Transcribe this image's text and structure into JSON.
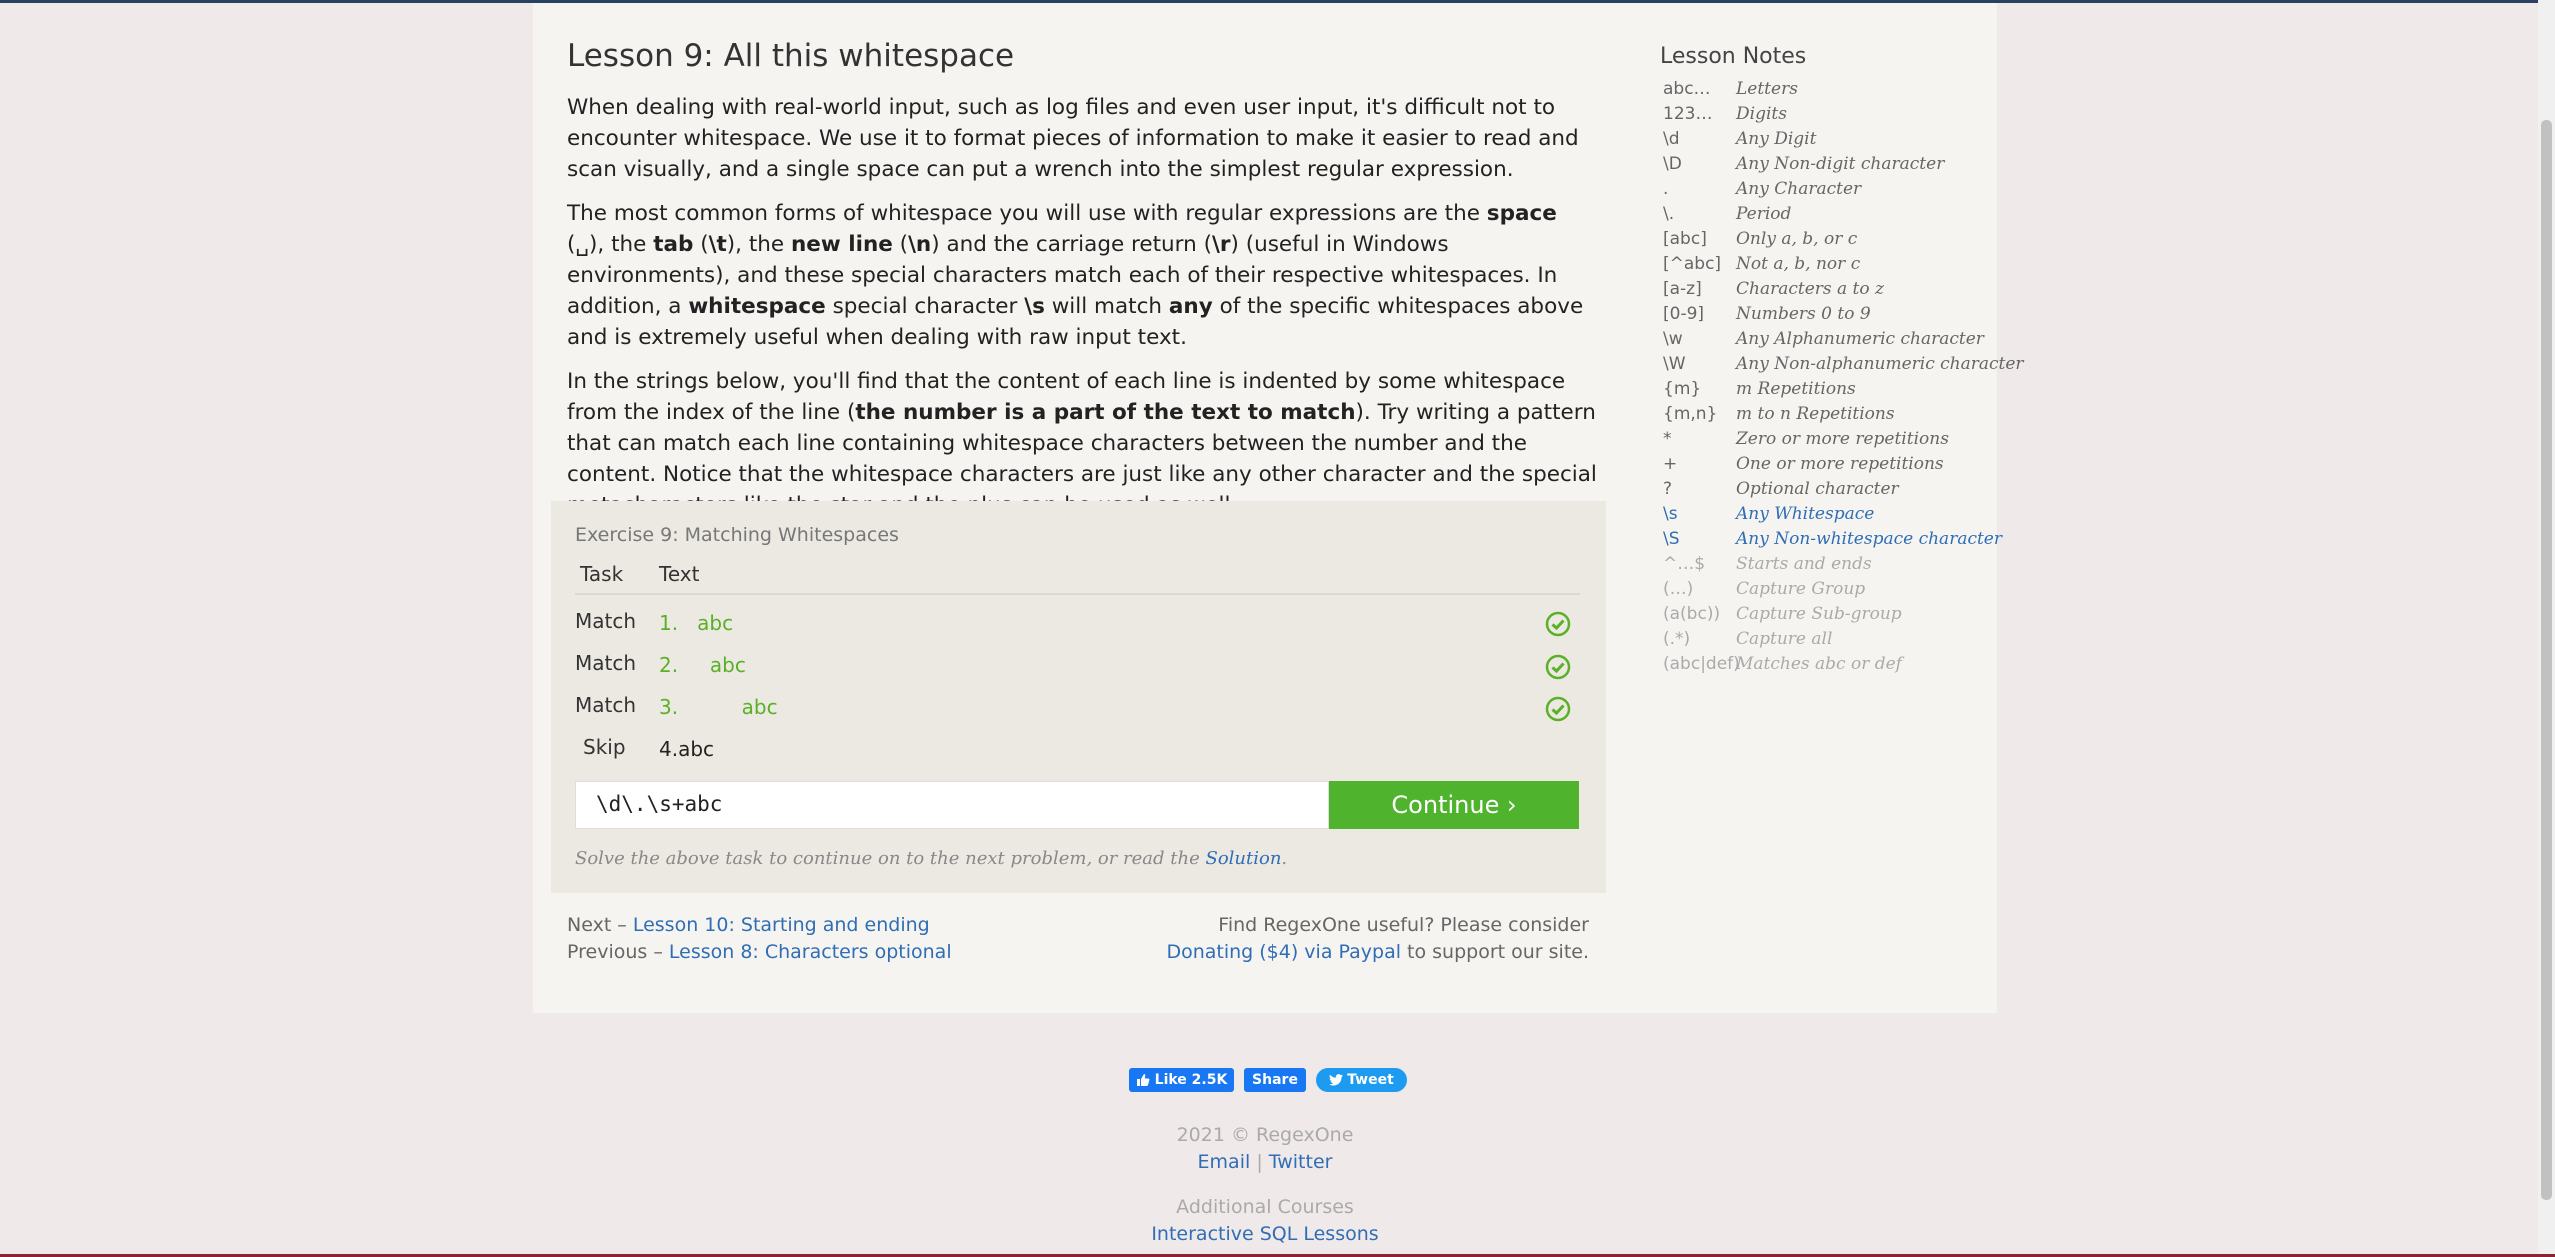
{
  "lesson": {
    "title": "Lesson 9: All this whitespace",
    "p1": "When dealing with real-world input, such as log files and even user input, it's difficult not to encounter whitespace. We use it to format pieces of information to make it easier to read and scan visually, and a single space can put a wrench into the simplest regular expression.",
    "p2": {
      "a": "The most common forms of whitespace you will use with regular expressions are the ",
      "b1": "space",
      "c": " (␣), the ",
      "b2": "tab",
      "d": " (",
      "b3": "\\t",
      "e": "), the ",
      "b4": "new line",
      "f": " (",
      "b5": "\\n",
      "g": ") and the carriage return (",
      "b6": "\\r",
      "h": ") (useful in Windows environments), and these special characters match each of their respective whitespaces. In addition, a ",
      "b7": "whitespace",
      "i": " special character ",
      "b8": "\\s",
      "j": " will match ",
      "b9": "any",
      "k": " of the specific whitespaces above and is extremely useful when dealing with raw input text."
    },
    "p3": {
      "a": "In the strings below, you'll find that the content of each line is indented by some whitespace from the index of the line (",
      "b": "the number is a part of the text to match",
      "c": "). Try writing a pattern that can match each line containing whitespace characters between the number and the content. Notice that the whitespace characters are just like any other character and the special metacharacters like the star and the plus can be used as well."
    }
  },
  "exercise": {
    "title": "Exercise 9: Matching Whitespaces",
    "col_task": "Task",
    "col_text": "Text",
    "rows": [
      {
        "task": "Match",
        "text": "1.   abc",
        "status": "matched"
      },
      {
        "task": "Match",
        "text": "2.     abc",
        "status": "matched"
      },
      {
        "task": "Match",
        "text": "3.          abc",
        "status": "matched"
      },
      {
        "task": "Skip",
        "text": "4.abc",
        "status": "none"
      }
    ],
    "input_value": "\\d\\.\\s+abc",
    "continue_label": "Continue ›",
    "hint_text": "Solve the above task to continue on to the next problem, or read the ",
    "hint_link": "Solution",
    "hint_end": "."
  },
  "nav": {
    "next_prefix": "Next – ",
    "next_link": "Lesson 10: Starting and ending",
    "prev_prefix": "Previous – ",
    "prev_link": "Lesson 8: Characters optional",
    "donate_line1": "Find RegexOne useful? Please consider",
    "donate_link": "Donating ($4) via Paypal",
    "donate_end": " to support our site."
  },
  "notes": {
    "title": "Lesson Notes",
    "items": [
      {
        "k": "abc…",
        "v": "Letters",
        "state": "normal"
      },
      {
        "k": "123…",
        "v": "Digits",
        "state": "normal"
      },
      {
        "k": "\\d",
        "v": "Any Digit",
        "state": "normal"
      },
      {
        "k": "\\D",
        "v": "Any Non-digit character",
        "state": "normal"
      },
      {
        "k": ".",
        "v": "Any Character",
        "state": "normal"
      },
      {
        "k": "\\.",
        "v": "Period",
        "state": "normal"
      },
      {
        "k": "[abc]",
        "v": "Only a, b, or c",
        "state": "normal"
      },
      {
        "k": "[^abc]",
        "v": "Not a, b, nor c",
        "state": "normal"
      },
      {
        "k": "[a-z]",
        "v": "Characters a to z",
        "state": "normal"
      },
      {
        "k": "[0-9]",
        "v": "Numbers 0 to 9",
        "state": "normal"
      },
      {
        "k": "\\w",
        "v": "Any Alphanumeric character",
        "state": "normal"
      },
      {
        "k": "\\W",
        "v": "Any Non-alphanumeric character",
        "state": "normal"
      },
      {
        "k": "{m}",
        "v": "m Repetitions",
        "state": "normal"
      },
      {
        "k": "{m,n}",
        "v": "m to n Repetitions",
        "state": "normal"
      },
      {
        "k": "*",
        "v": "Zero or more repetitions",
        "state": "normal"
      },
      {
        "k": "+",
        "v": "One or more repetitions",
        "state": "normal"
      },
      {
        "k": "?",
        "v": "Optional character",
        "state": "normal"
      },
      {
        "k": "\\s",
        "v": "Any Whitespace",
        "state": "hl"
      },
      {
        "k": "\\S",
        "v": "Any Non-whitespace character",
        "state": "hl"
      },
      {
        "k": "^…$",
        "v": "Starts and ends",
        "state": "dim"
      },
      {
        "k": "(…)",
        "v": "Capture Group",
        "state": "dim"
      },
      {
        "k": "(a(bc))",
        "v": "Capture Sub-group",
        "state": "dim"
      },
      {
        "k": "(.*)",
        "v": "Capture all",
        "state": "dim"
      },
      {
        "k": "(abc|def)",
        "v": "Matches abc or def",
        "state": "dim"
      }
    ]
  },
  "social": {
    "like": "Like 2.5K",
    "share": "Share",
    "tweet": "Tweet"
  },
  "footer": {
    "copyright": "2021 © RegexOne",
    "email": "Email",
    "sep": "|",
    "twitter": "Twitter",
    "additional": "Additional Courses",
    "sql": "Interactive SQL Lessons"
  },
  "colors": {
    "accent_green": "#4fb32e",
    "link_blue": "#2f6db5",
    "match_green": "#5ab026"
  }
}
